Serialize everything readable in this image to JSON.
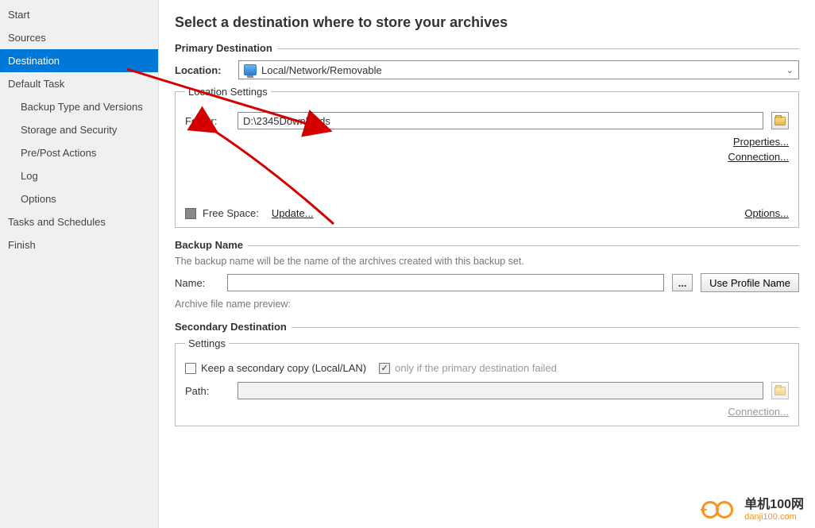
{
  "sidebar": {
    "items": [
      {
        "label": "Start"
      },
      {
        "label": "Sources"
      },
      {
        "label": "Destination",
        "selected": true
      },
      {
        "label": "Default Task"
      },
      {
        "label": "Backup Type and Versions",
        "indent": true
      },
      {
        "label": "Storage and Security",
        "indent": true
      },
      {
        "label": "Pre/Post Actions",
        "indent": true
      },
      {
        "label": "Log",
        "indent": true
      },
      {
        "label": "Options",
        "indent": true
      },
      {
        "label": "Tasks and Schedules"
      },
      {
        "label": "Finish"
      }
    ]
  },
  "main": {
    "title": "Select a destination where to store your archives",
    "primary": {
      "heading": "Primary Destination",
      "location_label": "Location:",
      "location_value": "Local/Network/Removable",
      "settings_legend": "Location Settings",
      "folder_label": "Folder:",
      "folder_value": "D:\\2345Downloads",
      "properties_link": "Properties...",
      "connection_link": "Connection...",
      "free_space_label": "Free Space:",
      "update_link": "Update...",
      "options_link": "Options..."
    },
    "backup": {
      "heading": "Backup Name",
      "desc": "The backup name will be the name of the archives created with this backup set.",
      "name_label": "Name:",
      "name_value": "",
      "use_profile_btn": "Use Profile Name",
      "preview_label": "Archive file name preview:"
    },
    "secondary": {
      "heading": "Secondary Destination",
      "settings_legend": "Settings",
      "keep_copy_label": "Keep a secondary copy (Local/LAN)",
      "only_if_label": "only if the primary destination failed",
      "path_label": "Path:",
      "path_value": "",
      "connection_link": "Connection..."
    }
  },
  "watermark": {
    "main": "单机100网",
    "sub": "danji100.com"
  }
}
